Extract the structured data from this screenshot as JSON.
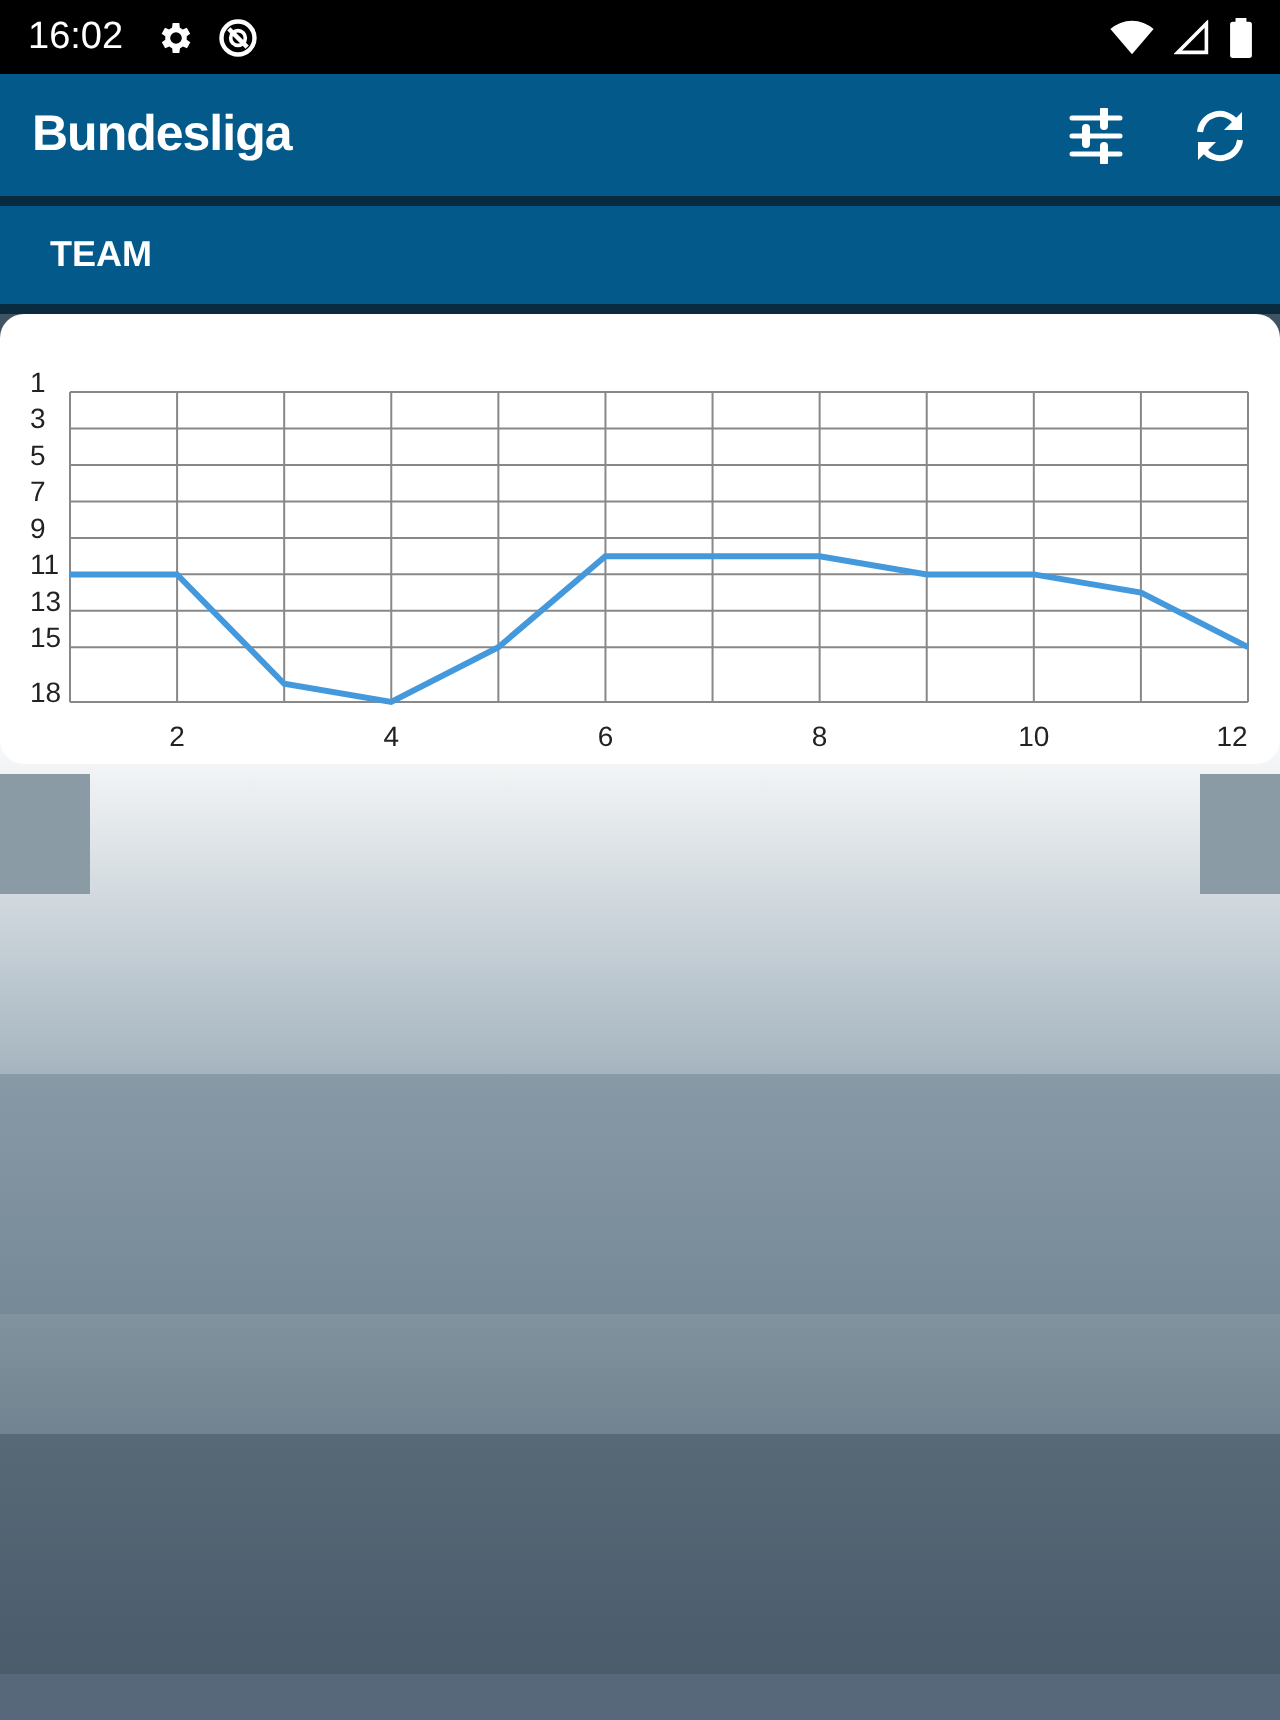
{
  "status_bar": {
    "time": "16:02"
  },
  "app_bar": {
    "title": "Bundesliga"
  },
  "section_header": {
    "label": "TEAM"
  },
  "chart_data": {
    "type": "line",
    "x": [
      1,
      2,
      3,
      4,
      5,
      6,
      7,
      8,
      9,
      10,
      11,
      12
    ],
    "series": [
      {
        "color": "#4499dd",
        "values": [
          11,
          11,
          17,
          18,
          15,
          10,
          10,
          10,
          11,
          11,
          12,
          15
        ]
      }
    ],
    "grid": true,
    "xlim": [
      1,
      12
    ],
    "ylim": [
      18,
      1
    ],
    "xticks": [
      2,
      4,
      6,
      8,
      10,
      12
    ],
    "yticks": [
      1,
      3,
      5,
      7,
      9,
      11,
      13,
      15,
      18
    ]
  }
}
